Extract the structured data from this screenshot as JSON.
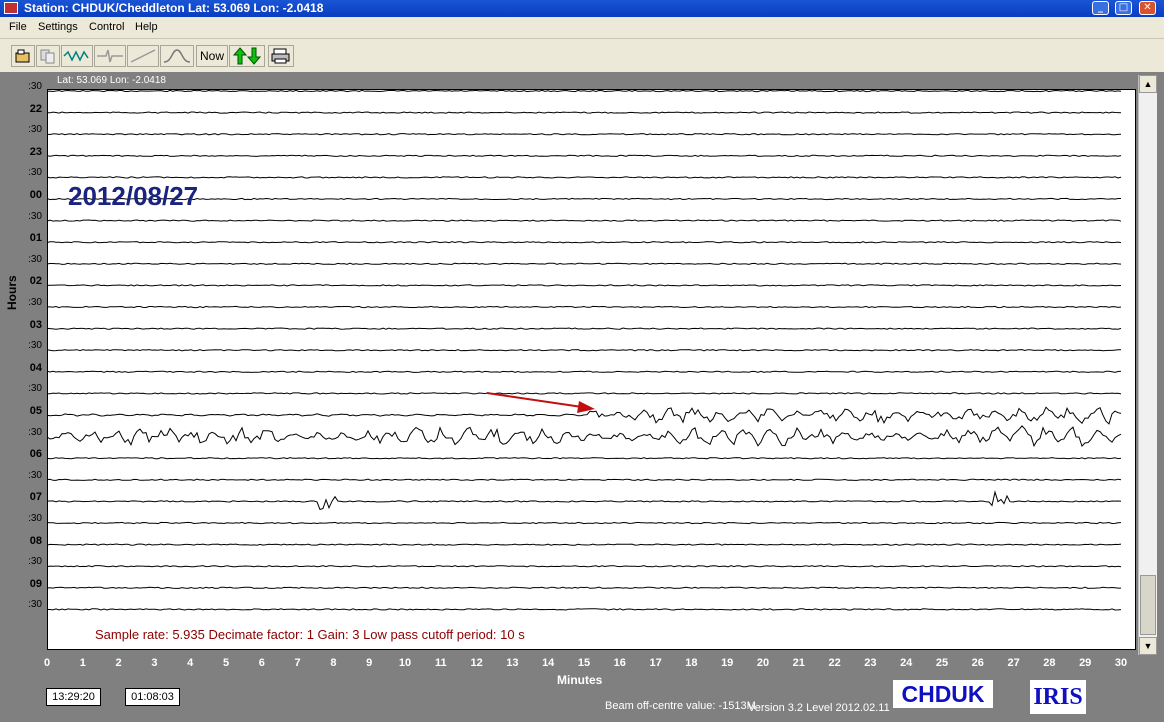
{
  "window": {
    "title": "Station: CHDUK/Cheddleton Lat: 53.069 Lon: -2.0418",
    "minimize_glyph": "_",
    "maximize_glyph": "□",
    "close_glyph": "✕"
  },
  "menu": [
    "File",
    "Settings",
    "Control",
    "Help"
  ],
  "toolbar": {
    "open_icon": "open-folder-icon",
    "copy_icon": "copy-icon",
    "wave_icon": "waveform-icon",
    "spike_icon": "spike-icon",
    "ramp_icon": "ramp-icon",
    "filter_icon": "filter-curve-icon",
    "now_label": "Now",
    "updown_icon": "up-down-arrows-icon",
    "print_icon": "printer-icon"
  },
  "plot": {
    "latlon": "Lat: 53.069 Lon: -2.0418",
    "date": "2012/08/27",
    "rows": [
      ":30",
      "22",
      ":30",
      "23",
      ":30",
      "00",
      ":30",
      "01",
      ":30",
      "02",
      ":30",
      "03",
      ":30",
      "04",
      ":30",
      "05",
      ":30",
      "06",
      ":30",
      "07",
      ":30",
      "08",
      ":30",
      "09",
      ":30"
    ],
    "hours_axis_label": "Hours",
    "minutes_axis_label": "Minutes",
    "minute_ticks": [
      "0",
      "1",
      "2",
      "3",
      "4",
      "5",
      "6",
      "7",
      "8",
      "9",
      "10",
      "11",
      "12",
      "13",
      "14",
      "15",
      "16",
      "17",
      "18",
      "19",
      "20",
      "21",
      "22",
      "23",
      "24",
      "25",
      "26",
      "27",
      "28",
      "29",
      "30"
    ],
    "info": "Sample rate: 5.935  Decimate factor: 1  Gain: 3  Low pass cutoff period: 10 s",
    "trace_color": "#000000",
    "arrow_color": "#c01010"
  },
  "scrollbar": {
    "up_glyph": "▲",
    "down_glyph": "▼"
  },
  "status": {
    "time_left": "13:29:20",
    "time_right": "01:08:03",
    "beam": "Beam off-centre value: -1513M",
    "version": "Version 3.2 Level 2012.02.11"
  },
  "logos": {
    "chduk": "CHDUK",
    "iris": "IRIS"
  }
}
